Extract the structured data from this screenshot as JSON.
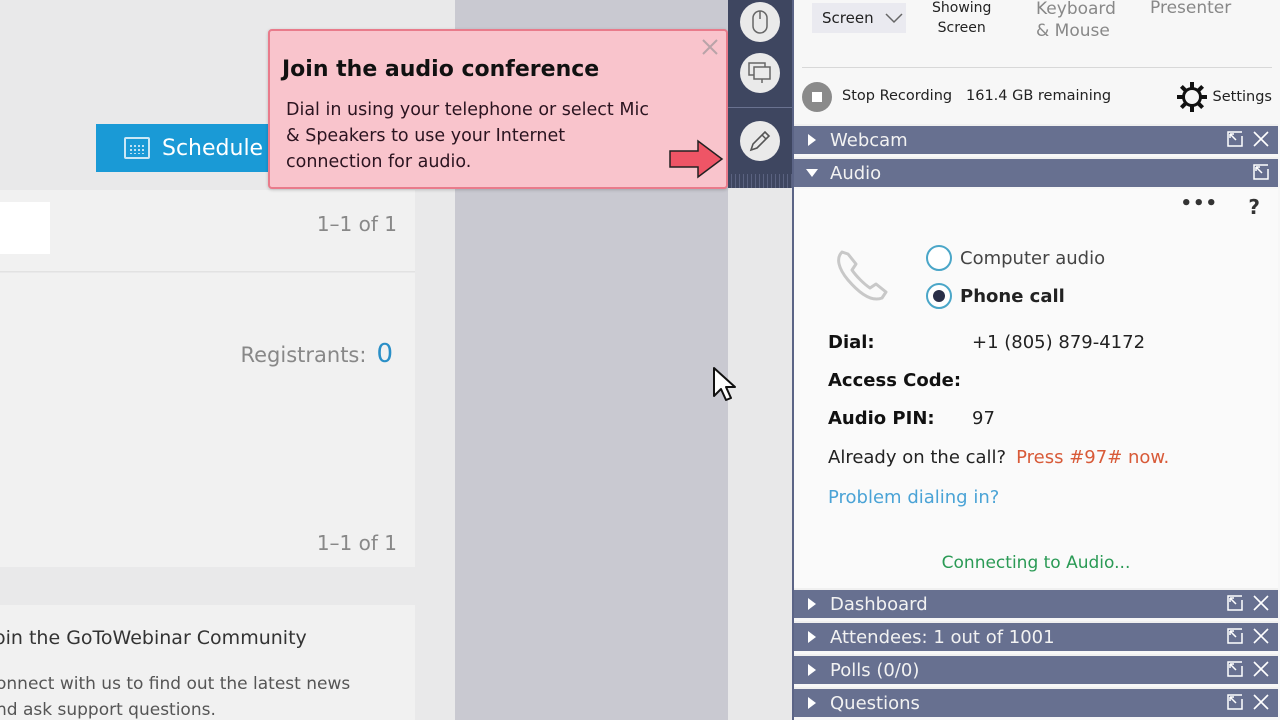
{
  "webpage": {
    "schedule_button": "Schedule",
    "pager_top": "1–1 of 1",
    "registrants_label": "Registrants:",
    "registrants_count": "0",
    "pager_bottom": "1–1 of 1",
    "community_title": "oin the GoToWebinar Community",
    "community_text_1": "onnect with us to find out the latest news",
    "community_text_2": "nd ask support questions."
  },
  "tooltip": {
    "title": "Join the audio conference",
    "body": "Dial in using your telephone or select Mic & Speakers to use your Internet connection for audio.",
    "close_icon": "close-icon",
    "arrow_icon": "arrow-right-icon",
    "colors": {
      "background": "#f9c4cc",
      "border": "#e97b8b",
      "arrow": "#ee5566"
    }
  },
  "strip": {
    "buttons": [
      {
        "icon": "mouse-icon"
      },
      {
        "icon": "screens-icon"
      },
      {
        "icon": "pencil-icon"
      }
    ]
  },
  "panel": {
    "screen_dropdown": "Screen",
    "showing_screen_1": "Showing",
    "showing_screen_2": "Screen",
    "keyboard_mouse_1": "Keyboard",
    "keyboard_mouse_2": "& Mouse",
    "presenter": "Presenter",
    "stop_recording": "Stop Recording",
    "gb_remaining": "161.4 GB remaining",
    "settings": "Settings",
    "sections": {
      "webcam": "Webcam",
      "audio": "Audio",
      "dashboard": "Dashboard",
      "attendees": "Attendees: 1 out of 1001",
      "polls": "Polls (0/0)",
      "questions": "Questions"
    },
    "audio": {
      "more": "•••",
      "help": "?",
      "option_computer": "Computer audio",
      "option_phone": "Phone call",
      "selected": "Phone call",
      "dial_label": "Dial:",
      "dial_value": "+1 (805) 879-4172",
      "access_code_label": "Access Code:",
      "access_code_value": "",
      "pin_label": "Audio PIN:",
      "pin_value": "97",
      "already_label": "Already on the call?",
      "already_action": "Press #97# now.",
      "problem_link": "Problem dialing in?",
      "status": "Connecting to Audio..."
    },
    "colors": {
      "header": "#677090",
      "accent_blue": "#4aa3d6",
      "status_green": "#2a9a55",
      "press_orange": "#d85a38"
    }
  }
}
